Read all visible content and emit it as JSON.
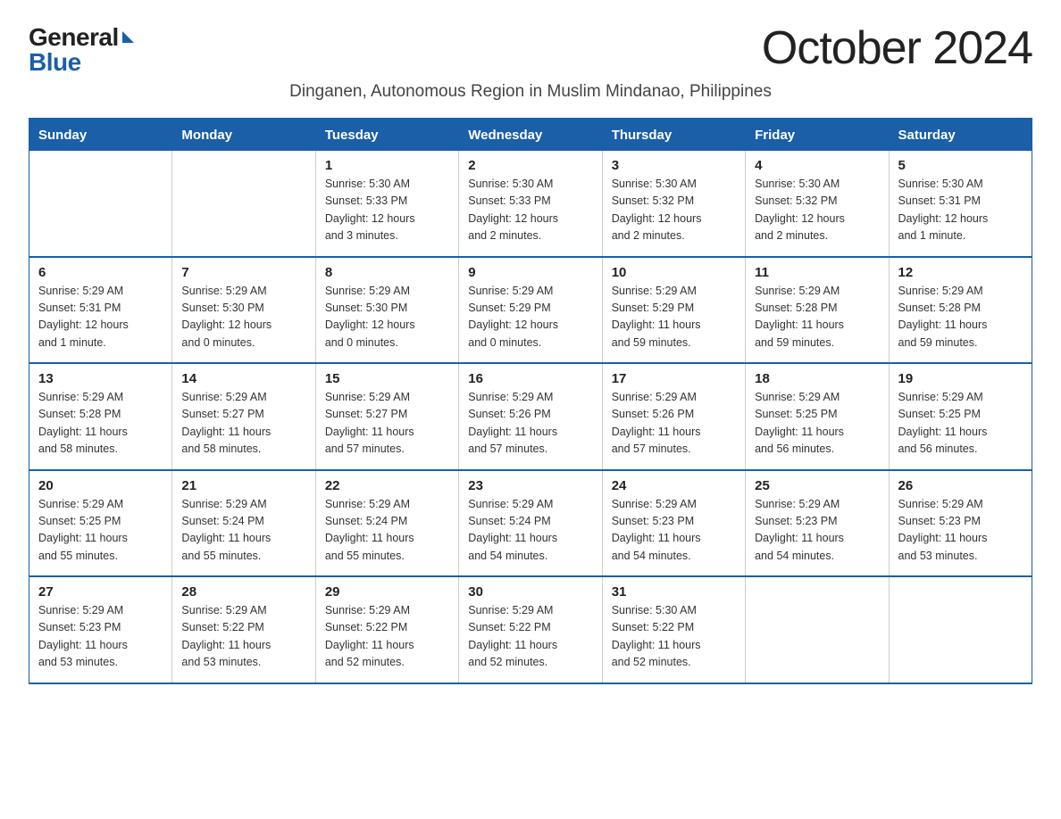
{
  "logo": {
    "general": "General",
    "blue": "Blue"
  },
  "title": "October 2024",
  "subtitle": "Dinganen, Autonomous Region in Muslim Mindanao, Philippines",
  "days_of_week": [
    "Sunday",
    "Monday",
    "Tuesday",
    "Wednesday",
    "Thursday",
    "Friday",
    "Saturday"
  ],
  "weeks": [
    [
      {
        "day": "",
        "info": ""
      },
      {
        "day": "",
        "info": ""
      },
      {
        "day": "1",
        "info": "Sunrise: 5:30 AM\nSunset: 5:33 PM\nDaylight: 12 hours\nand 3 minutes."
      },
      {
        "day": "2",
        "info": "Sunrise: 5:30 AM\nSunset: 5:33 PM\nDaylight: 12 hours\nand 2 minutes."
      },
      {
        "day": "3",
        "info": "Sunrise: 5:30 AM\nSunset: 5:32 PM\nDaylight: 12 hours\nand 2 minutes."
      },
      {
        "day": "4",
        "info": "Sunrise: 5:30 AM\nSunset: 5:32 PM\nDaylight: 12 hours\nand 2 minutes."
      },
      {
        "day": "5",
        "info": "Sunrise: 5:30 AM\nSunset: 5:31 PM\nDaylight: 12 hours\nand 1 minute."
      }
    ],
    [
      {
        "day": "6",
        "info": "Sunrise: 5:29 AM\nSunset: 5:31 PM\nDaylight: 12 hours\nand 1 minute."
      },
      {
        "day": "7",
        "info": "Sunrise: 5:29 AM\nSunset: 5:30 PM\nDaylight: 12 hours\nand 0 minutes."
      },
      {
        "day": "8",
        "info": "Sunrise: 5:29 AM\nSunset: 5:30 PM\nDaylight: 12 hours\nand 0 minutes."
      },
      {
        "day": "9",
        "info": "Sunrise: 5:29 AM\nSunset: 5:29 PM\nDaylight: 12 hours\nand 0 minutes."
      },
      {
        "day": "10",
        "info": "Sunrise: 5:29 AM\nSunset: 5:29 PM\nDaylight: 11 hours\nand 59 minutes."
      },
      {
        "day": "11",
        "info": "Sunrise: 5:29 AM\nSunset: 5:28 PM\nDaylight: 11 hours\nand 59 minutes."
      },
      {
        "day": "12",
        "info": "Sunrise: 5:29 AM\nSunset: 5:28 PM\nDaylight: 11 hours\nand 59 minutes."
      }
    ],
    [
      {
        "day": "13",
        "info": "Sunrise: 5:29 AM\nSunset: 5:28 PM\nDaylight: 11 hours\nand 58 minutes."
      },
      {
        "day": "14",
        "info": "Sunrise: 5:29 AM\nSunset: 5:27 PM\nDaylight: 11 hours\nand 58 minutes."
      },
      {
        "day": "15",
        "info": "Sunrise: 5:29 AM\nSunset: 5:27 PM\nDaylight: 11 hours\nand 57 minutes."
      },
      {
        "day": "16",
        "info": "Sunrise: 5:29 AM\nSunset: 5:26 PM\nDaylight: 11 hours\nand 57 minutes."
      },
      {
        "day": "17",
        "info": "Sunrise: 5:29 AM\nSunset: 5:26 PM\nDaylight: 11 hours\nand 57 minutes."
      },
      {
        "day": "18",
        "info": "Sunrise: 5:29 AM\nSunset: 5:25 PM\nDaylight: 11 hours\nand 56 minutes."
      },
      {
        "day": "19",
        "info": "Sunrise: 5:29 AM\nSunset: 5:25 PM\nDaylight: 11 hours\nand 56 minutes."
      }
    ],
    [
      {
        "day": "20",
        "info": "Sunrise: 5:29 AM\nSunset: 5:25 PM\nDaylight: 11 hours\nand 55 minutes."
      },
      {
        "day": "21",
        "info": "Sunrise: 5:29 AM\nSunset: 5:24 PM\nDaylight: 11 hours\nand 55 minutes."
      },
      {
        "day": "22",
        "info": "Sunrise: 5:29 AM\nSunset: 5:24 PM\nDaylight: 11 hours\nand 55 minutes."
      },
      {
        "day": "23",
        "info": "Sunrise: 5:29 AM\nSunset: 5:24 PM\nDaylight: 11 hours\nand 54 minutes."
      },
      {
        "day": "24",
        "info": "Sunrise: 5:29 AM\nSunset: 5:23 PM\nDaylight: 11 hours\nand 54 minutes."
      },
      {
        "day": "25",
        "info": "Sunrise: 5:29 AM\nSunset: 5:23 PM\nDaylight: 11 hours\nand 54 minutes."
      },
      {
        "day": "26",
        "info": "Sunrise: 5:29 AM\nSunset: 5:23 PM\nDaylight: 11 hours\nand 53 minutes."
      }
    ],
    [
      {
        "day": "27",
        "info": "Sunrise: 5:29 AM\nSunset: 5:23 PM\nDaylight: 11 hours\nand 53 minutes."
      },
      {
        "day": "28",
        "info": "Sunrise: 5:29 AM\nSunset: 5:22 PM\nDaylight: 11 hours\nand 53 minutes."
      },
      {
        "day": "29",
        "info": "Sunrise: 5:29 AM\nSunset: 5:22 PM\nDaylight: 11 hours\nand 52 minutes."
      },
      {
        "day": "30",
        "info": "Sunrise: 5:29 AM\nSunset: 5:22 PM\nDaylight: 11 hours\nand 52 minutes."
      },
      {
        "day": "31",
        "info": "Sunrise: 5:30 AM\nSunset: 5:22 PM\nDaylight: 11 hours\nand 52 minutes."
      },
      {
        "day": "",
        "info": ""
      },
      {
        "day": "",
        "info": ""
      }
    ]
  ]
}
